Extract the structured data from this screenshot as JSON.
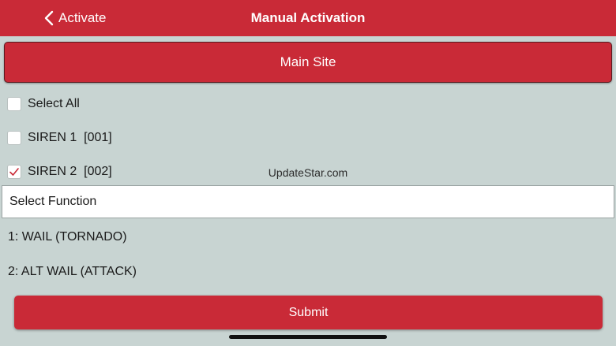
{
  "colors": {
    "accent": "#c92a37",
    "background": "#c8d4d2",
    "check_mark": "#c92a37"
  },
  "navbar": {
    "back_icon": "chevron-left-icon",
    "back_label": "Activate",
    "title": "Manual Activation"
  },
  "site_button": {
    "label": "Main Site"
  },
  "checklist": [
    {
      "label": "Select All",
      "checked": false
    },
    {
      "label": "SIREN 1  [001]",
      "checked": false
    },
    {
      "label": "SIREN 2  [002]",
      "checked": true
    }
  ],
  "watermark": "UpdateStar.com",
  "function_select": {
    "label": "Select Function"
  },
  "functions": [
    {
      "label": "1: WAIL (TORNADO)"
    },
    {
      "label": "2: ALT WAIL (ATTACK)"
    }
  ],
  "submit": {
    "label": "Submit"
  }
}
